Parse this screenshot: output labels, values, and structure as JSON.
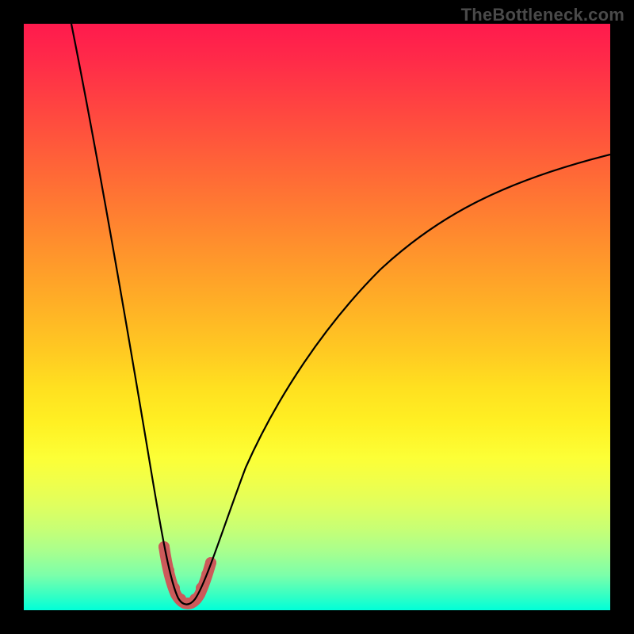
{
  "watermark": "TheBottleneck.com",
  "chart_data": {
    "type": "line",
    "title": "",
    "xlabel": "",
    "ylabel": "",
    "xlim": [
      0,
      100
    ],
    "ylim": [
      0,
      100
    ],
    "grid": false,
    "legend": false,
    "background": "red-green vertical gradient (red top, green bottom)",
    "series": [
      {
        "name": "bottleneck-curve",
        "x": [
          8,
          10,
          12,
          14,
          16,
          18,
          20,
          21,
          22,
          23,
          24,
          25,
          26,
          27,
          28,
          29,
          30,
          32,
          35,
          40,
          45,
          50,
          55,
          60,
          65,
          70,
          75,
          80,
          85,
          90,
          95,
          100
        ],
        "values": [
          100,
          89,
          78,
          67,
          57,
          47,
          38,
          31,
          24,
          17,
          11,
          6,
          3,
          2,
          2,
          3,
          5,
          10,
          17,
          27,
          35,
          42,
          48,
          53,
          57,
          61,
          65,
          68,
          71,
          73,
          76,
          78
        ]
      }
    ],
    "highlight_range_x": [
      24,
      30
    ],
    "highlight_color": "#cc5a5a",
    "curve_minimum": {
      "x": 27,
      "value": 2
    }
  }
}
